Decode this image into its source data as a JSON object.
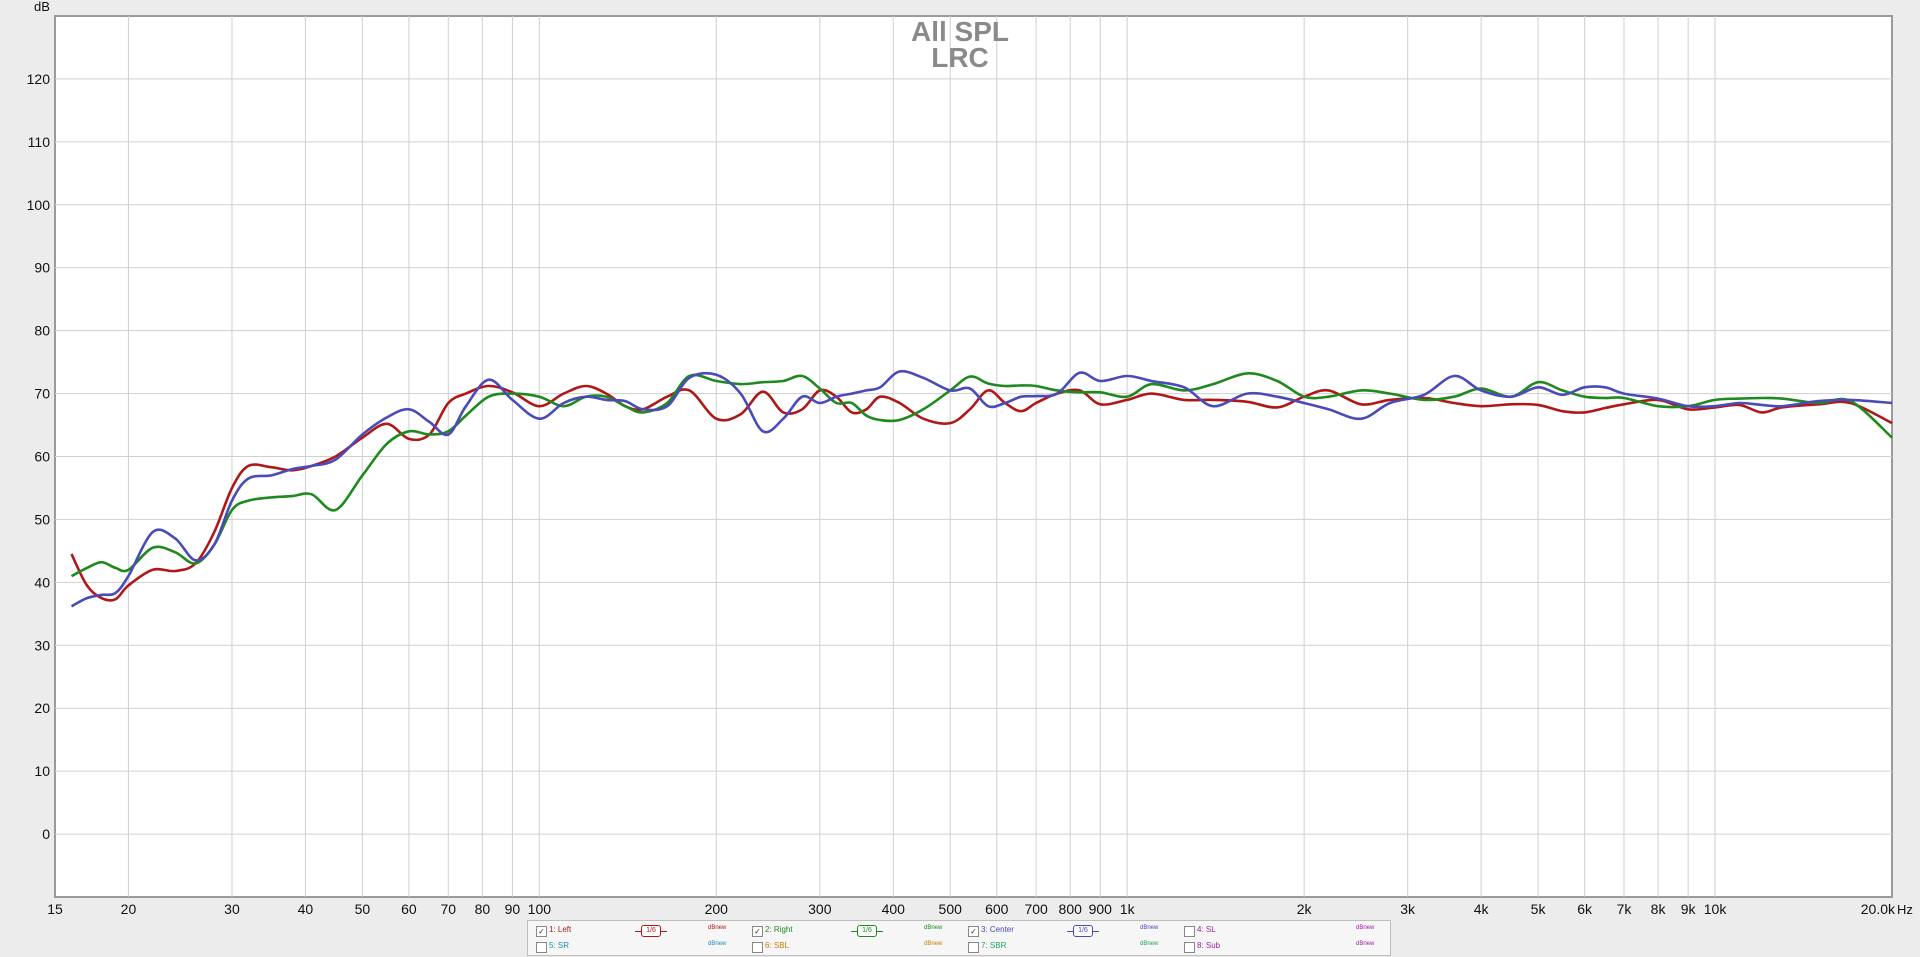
{
  "chart_data": {
    "type": "line",
    "title": "All SPL",
    "subtitle": "LRC",
    "ylabel": "dB",
    "xlabel_unit": "Hz",
    "x_scale": "log",
    "xlim": [
      15,
      20000
    ],
    "ylim": [
      -10,
      130
    ],
    "grid": true,
    "y_ticks": [
      0,
      10,
      20,
      30,
      40,
      50,
      60,
      70,
      80,
      90,
      100,
      110,
      120
    ],
    "x_ticks": [
      {
        "value": 15,
        "label": "15"
      },
      {
        "value": 20,
        "label": "20"
      },
      {
        "value": 30,
        "label": "30"
      },
      {
        "value": 40,
        "label": "40"
      },
      {
        "value": 50,
        "label": "50"
      },
      {
        "value": 60,
        "label": "60"
      },
      {
        "value": 70,
        "label": "70"
      },
      {
        "value": 80,
        "label": "80"
      },
      {
        "value": 90,
        "label": "90"
      },
      {
        "value": 100,
        "label": "100"
      },
      {
        "value": 200,
        "label": "200"
      },
      {
        "value": 300,
        "label": "300"
      },
      {
        "value": 400,
        "label": "400"
      },
      {
        "value": 500,
        "label": "500"
      },
      {
        "value": 600,
        "label": "600"
      },
      {
        "value": 700,
        "label": "700"
      },
      {
        "value": 800,
        "label": "800"
      },
      {
        "value": 900,
        "label": "900"
      },
      {
        "value": 1000,
        "label": "1k"
      },
      {
        "value": 2000,
        "label": "2k"
      },
      {
        "value": 3000,
        "label": "3k"
      },
      {
        "value": 4000,
        "label": "4k"
      },
      {
        "value": 5000,
        "label": "5k"
      },
      {
        "value": 6000,
        "label": "6k"
      },
      {
        "value": 7000,
        "label": "7k"
      },
      {
        "value": 8000,
        "label": "8k"
      },
      {
        "value": 9000,
        "label": "9k"
      },
      {
        "value": 10000,
        "label": "10k"
      },
      {
        "value": 20000,
        "label": "20.0k"
      }
    ],
    "series": [
      {
        "name": "1: Left",
        "color": "#b01818",
        "x": [
          16,
          17,
          18,
          19,
          20,
          22,
          24,
          26,
          28,
          30,
          32,
          35,
          38,
          41,
          45,
          50,
          55,
          60,
          65,
          70,
          75,
          82,
          90,
          100,
          110,
          120,
          130,
          140,
          150,
          165,
          180,
          200,
          220,
          240,
          260,
          280,
          300,
          320,
          340,
          360,
          380,
          410,
          450,
          500,
          540,
          580,
          620,
          660,
          700,
          760,
          830,
          900,
          1000,
          1100,
          1250,
          1400,
          1600,
          1800,
          2000,
          2200,
          2500,
          2800,
          3200,
          3600,
          4000,
          4500,
          5000,
          5500,
          6000,
          6500,
          7000,
          8000,
          9000,
          10000,
          11000,
          12000,
          13000,
          15000,
          17000,
          20000
        ],
        "y": [
          44.5,
          39.5,
          37.5,
          37.3,
          39.5,
          42,
          41.8,
          43,
          48,
          55,
          58.5,
          58.3,
          57.8,
          58.5,
          60,
          63,
          65.2,
          62.8,
          63.5,
          68.5,
          70,
          71.2,
          70.2,
          68,
          70,
          71.2,
          70,
          68,
          67.5,
          69.5,
          70.5,
          66,
          66.7,
          70.3,
          67,
          67.5,
          70.5,
          69.5,
          67,
          67.5,
          69.5,
          68.5,
          66,
          65.3,
          67.5,
          70.5,
          68.5,
          67.2,
          68.5,
          70,
          70.5,
          68.3,
          69,
          70,
          69,
          69,
          68.7,
          67.8,
          69.5,
          70.5,
          68.3,
          69,
          69.3,
          68.5,
          68,
          68.3,
          68.2,
          67.2,
          67,
          67.7,
          68.3,
          69,
          67.5,
          67.8,
          68.2,
          67,
          67.8,
          68.3,
          68.5,
          65.3
        ]
      },
      {
        "name": "2: Right",
        "color": "#1e8a1e",
        "x": [
          16,
          17,
          18,
          19,
          20,
          22,
          24,
          26,
          28,
          30,
          32,
          35,
          38,
          41,
          45,
          50,
          55,
          60,
          65,
          70,
          75,
          82,
          90,
          100,
          110,
          120,
          130,
          140,
          150,
          165,
          180,
          200,
          220,
          240,
          260,
          280,
          300,
          320,
          340,
          360,
          380,
          410,
          450,
          500,
          540,
          580,
          620,
          660,
          700,
          760,
          830,
          900,
          1000,
          1100,
          1250,
          1400,
          1600,
          1800,
          2000,
          2200,
          2500,
          2800,
          3200,
          3600,
          4000,
          4500,
          5000,
          5500,
          6000,
          6500,
          7000,
          8000,
          9000,
          10000,
          11000,
          12000,
          13000,
          15000,
          17000,
          20000
        ],
        "y": [
          41,
          42.3,
          43.2,
          42.3,
          42,
          45.5,
          44.8,
          43,
          46,
          51.5,
          53,
          53.5,
          53.7,
          54,
          51.5,
          57,
          62,
          64,
          63.5,
          64,
          66.5,
          69.5,
          70,
          69.5,
          68,
          69.5,
          69.5,
          68,
          67,
          68.5,
          72.8,
          72,
          71.5,
          71.8,
          72,
          72.8,
          70.8,
          68.5,
          68.5,
          66.5,
          65.8,
          65.8,
          67.5,
          70.5,
          72.7,
          71.6,
          71.2,
          71.3,
          71.2,
          70.5,
          70.2,
          70.2,
          69.5,
          71.5,
          70.5,
          71.5,
          73.2,
          72,
          69.5,
          69.5,
          70.5,
          70,
          69,
          69.5,
          70.8,
          69.5,
          71.8,
          70.5,
          69.5,
          69.3,
          69.3,
          68,
          68,
          69,
          69.2,
          69.3,
          69.2,
          68.5,
          68.8,
          63
        ]
      },
      {
        "name": "3: Center",
        "color": "#4a4ab8",
        "x": [
          16,
          17,
          18,
          19,
          20,
          22,
          24,
          26,
          28,
          30,
          32,
          35,
          38,
          41,
          45,
          50,
          55,
          60,
          65,
          70,
          75,
          82,
          90,
          100,
          110,
          120,
          130,
          140,
          150,
          165,
          180,
          200,
          220,
          240,
          260,
          280,
          300,
          320,
          340,
          360,
          380,
          410,
          450,
          500,
          540,
          580,
          620,
          660,
          700,
          760,
          830,
          900,
          1000,
          1100,
          1250,
          1400,
          1600,
          1800,
          2000,
          2200,
          2500,
          2800,
          3200,
          3600,
          4000,
          4500,
          5000,
          5500,
          6000,
          6500,
          7000,
          8000,
          9000,
          10000,
          11000,
          12000,
          13000,
          15000,
          17000,
          20000
        ],
        "y": [
          36.2,
          37.5,
          38,
          38.3,
          41,
          48,
          47,
          43.5,
          46,
          53,
          56.5,
          57,
          58,
          58.5,
          59.5,
          63.5,
          66.2,
          67.5,
          65.5,
          63.5,
          68,
          72.2,
          69,
          66,
          68.5,
          69.5,
          69,
          68.8,
          67.5,
          68,
          72.5,
          73,
          70,
          64,
          66,
          69.5,
          68.5,
          69.5,
          70,
          70.5,
          71,
          73.5,
          72.5,
          70.5,
          70.8,
          68,
          68.5,
          69.5,
          69.6,
          70,
          73.3,
          72,
          72.8,
          72,
          71,
          68,
          70,
          69.5,
          68.5,
          67.5,
          66,
          68.5,
          69.8,
          72.8,
          70.5,
          69.5,
          71,
          69.8,
          71,
          71,
          70,
          69.2,
          68,
          68,
          68.5,
          68.2,
          68,
          68.8,
          69,
          68.5
        ]
      }
    ]
  },
  "legend": {
    "smooth_label": "1/6",
    "db_label": "dBnew",
    "items": [
      {
        "name": "1: Left",
        "color": "#b01818",
        "checked": true
      },
      {
        "name": "2: Right",
        "color": "#1e8a1e",
        "checked": true
      },
      {
        "name": "3: Center",
        "color": "#4a4ab8",
        "checked": true
      },
      {
        "name": "4: SL",
        "color": "#a020a0",
        "checked": false
      },
      {
        "name": "5: SR",
        "color": "#1e8ab0",
        "checked": false
      },
      {
        "name": "6: SBL",
        "color": "#c08000",
        "checked": false
      },
      {
        "name": "7: SBR",
        "color": "#20a060",
        "checked": false
      },
      {
        "name": "8: Sub",
        "color": "#a020a0",
        "checked": false
      }
    ]
  }
}
